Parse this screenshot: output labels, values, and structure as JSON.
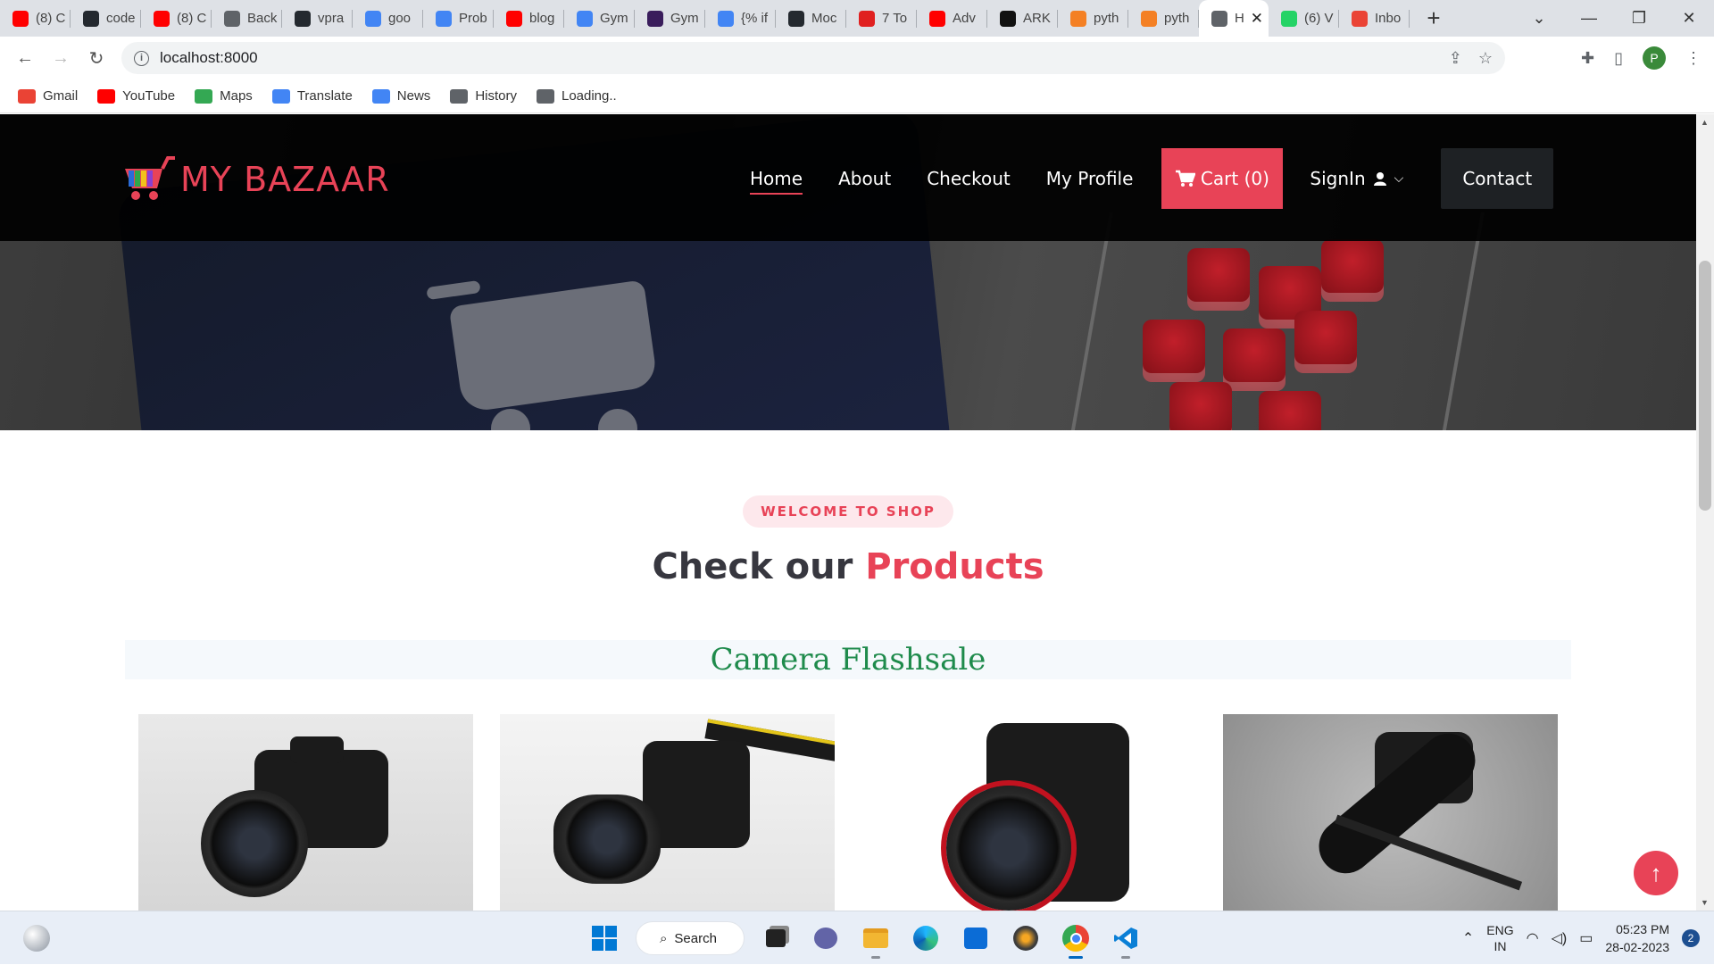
{
  "browser": {
    "tabs": [
      {
        "title": "(8) C",
        "icon": "youtube-icon",
        "color": "#ff0000"
      },
      {
        "title": "code",
        "icon": "github-icon",
        "color": "#24292f"
      },
      {
        "title": "(8) C",
        "icon": "youtube-icon",
        "color": "#ff0000"
      },
      {
        "title": "Back",
        "icon": "globe-icon",
        "color": "#5f6368"
      },
      {
        "title": "vpra",
        "icon": "github-icon",
        "color": "#24292f"
      },
      {
        "title": "goo",
        "icon": "google-icon",
        "color": "#4285f4"
      },
      {
        "title": "Prob",
        "icon": "chart-icon",
        "color": "#4285f4"
      },
      {
        "title": "blog",
        "icon": "youtube-icon",
        "color": "#ff0000"
      },
      {
        "title": "Gym",
        "icon": "google-icon",
        "color": "#4285f4"
      },
      {
        "title": "Gym",
        "icon": "bootstrap-icon",
        "color": "#3a1d5c"
      },
      {
        "title": "{% if",
        "icon": "google-icon",
        "color": "#4285f4"
      },
      {
        "title": "Moc",
        "icon": "github-icon",
        "color": "#24292f"
      },
      {
        "title": "7 To",
        "icon": "shield-icon",
        "color": "#e02020"
      },
      {
        "title": "Adv",
        "icon": "youtube-icon",
        "color": "#ff0000"
      },
      {
        "title": "ARK",
        "icon": "dot-icon",
        "color": "#111111"
      },
      {
        "title": "pyth",
        "icon": "stackoverflow-icon",
        "color": "#f48024"
      },
      {
        "title": "pyth",
        "icon": "stackoverflow-icon",
        "color": "#f48024"
      },
      {
        "title": "H",
        "icon": "globe-icon",
        "color": "#5f6368",
        "active": true
      },
      {
        "title": "(6) V",
        "icon": "whatsapp-icon",
        "color": "#25d366"
      },
      {
        "title": "Inbo",
        "icon": "gmail-icon",
        "color": "#ea4335"
      }
    ],
    "address": "localhost:8000",
    "profile_initial": "P",
    "bookmarks": [
      {
        "label": "Gmail",
        "icon": "gmail-icon"
      },
      {
        "label": "YouTube",
        "icon": "youtube-icon"
      },
      {
        "label": "Maps",
        "icon": "maps-icon"
      },
      {
        "label": "Translate",
        "icon": "translate-icon"
      },
      {
        "label": "News",
        "icon": "news-icon"
      },
      {
        "label": "History",
        "icon": "history-icon"
      },
      {
        "label": "Loading..",
        "icon": "globe-icon"
      }
    ]
  },
  "site": {
    "brand": "MY BAZAAR",
    "nav": {
      "home": "Home",
      "about": "About",
      "checkout": "Checkout",
      "profile": "My Profile",
      "cart": "Cart (0)",
      "signin": "SignIn",
      "contact": "Contact"
    },
    "section": {
      "pill": "WELCOME TO SHOP",
      "title_plain": "Check our",
      "title_accent": "Products",
      "category": "Camera Flashsale"
    },
    "products": [
      {
        "name": "camera-product-1"
      },
      {
        "name": "camera-product-2"
      },
      {
        "name": "camera-product-3"
      },
      {
        "name": "camera-product-4"
      }
    ],
    "colors": {
      "accent": "#e84357",
      "category": "#1f8b4c",
      "header_bg": "#000000"
    }
  },
  "taskbar": {
    "search_label": "Search",
    "lang_line1": "ENG",
    "lang_line2": "IN",
    "time": "05:23 PM",
    "date": "28-02-2023",
    "notifications": "2"
  }
}
